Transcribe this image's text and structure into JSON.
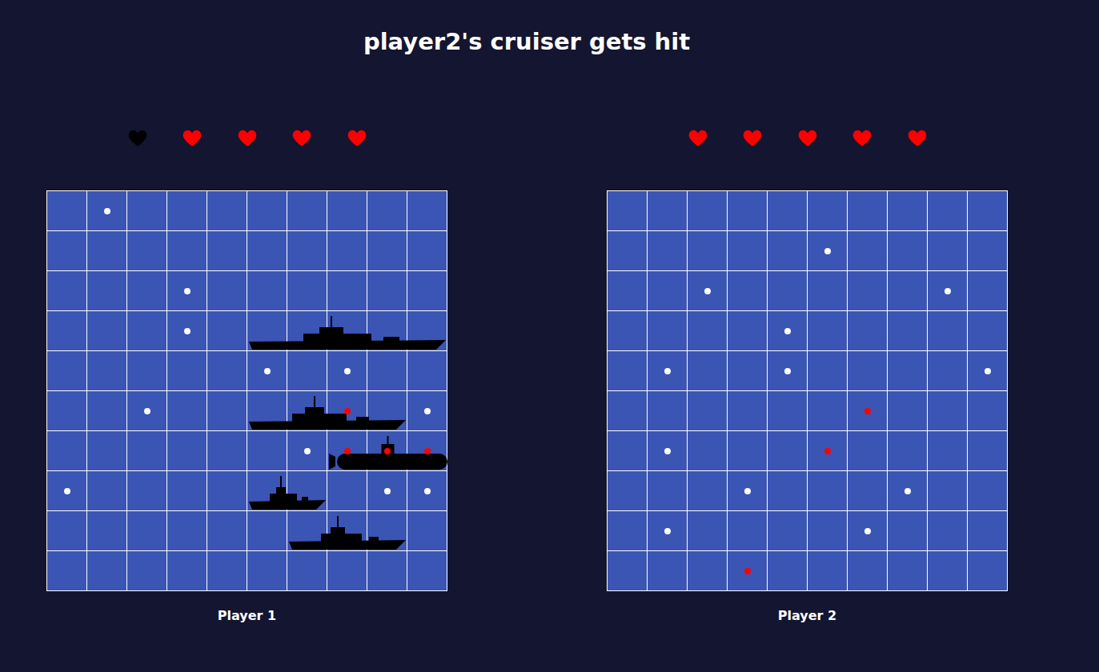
{
  "title": "player2's cruiser gets hit",
  "players": [
    {
      "name": "Player 1",
      "hearts": [
        {
          "lost": true
        },
        {
          "lost": false
        },
        {
          "lost": false
        },
        {
          "lost": false
        },
        {
          "lost": false
        }
      ],
      "ships": [
        {
          "kind": "surface",
          "row": 3,
          "col": 5,
          "length": 5
        },
        {
          "kind": "surface",
          "row": 5,
          "col": 5,
          "length": 4
        },
        {
          "kind": "submarine",
          "row": 6,
          "col": 7,
          "length": 3
        },
        {
          "kind": "surface",
          "row": 7,
          "col": 5,
          "length": 2
        },
        {
          "kind": "surface",
          "row": 8,
          "col": 6,
          "length": 3
        }
      ],
      "shots": [
        {
          "row": 0,
          "col": 1,
          "hit": false
        },
        {
          "row": 2,
          "col": 3,
          "hit": false
        },
        {
          "row": 3,
          "col": 3,
          "hit": false
        },
        {
          "row": 4,
          "col": 5,
          "hit": false
        },
        {
          "row": 4,
          "col": 7,
          "hit": false
        },
        {
          "row": 5,
          "col": 2,
          "hit": false
        },
        {
          "row": 5,
          "col": 9,
          "hit": false
        },
        {
          "row": 6,
          "col": 6,
          "hit": false
        },
        {
          "row": 7,
          "col": 0,
          "hit": false
        },
        {
          "row": 7,
          "col": 8,
          "hit": false
        },
        {
          "row": 7,
          "col": 9,
          "hit": false
        },
        {
          "row": 5,
          "col": 7,
          "hit": true
        },
        {
          "row": 6,
          "col": 7,
          "hit": true
        },
        {
          "row": 6,
          "col": 8,
          "hit": true
        },
        {
          "row": 6,
          "col": 9,
          "hit": true
        }
      ]
    },
    {
      "name": "Player 2",
      "hearts": [
        {
          "lost": false
        },
        {
          "lost": false
        },
        {
          "lost": false
        },
        {
          "lost": false
        },
        {
          "lost": false
        }
      ],
      "ships": [],
      "shots": [
        {
          "row": 1,
          "col": 5,
          "hit": false
        },
        {
          "row": 2,
          "col": 2,
          "hit": false
        },
        {
          "row": 2,
          "col": 8,
          "hit": false
        },
        {
          "row": 3,
          "col": 4,
          "hit": false
        },
        {
          "row": 4,
          "col": 1,
          "hit": false
        },
        {
          "row": 4,
          "col": 4,
          "hit": false
        },
        {
          "row": 4,
          "col": 9,
          "hit": false
        },
        {
          "row": 6,
          "col": 1,
          "hit": false
        },
        {
          "row": 7,
          "col": 3,
          "hit": false
        },
        {
          "row": 7,
          "col": 7,
          "hit": false
        },
        {
          "row": 8,
          "col": 1,
          "hit": false
        },
        {
          "row": 8,
          "col": 6,
          "hit": false
        },
        {
          "row": 5,
          "col": 6,
          "hit": true
        },
        {
          "row": 6,
          "col": 5,
          "hit": true
        },
        {
          "row": 9,
          "col": 3,
          "hit": true
        }
      ]
    }
  ]
}
